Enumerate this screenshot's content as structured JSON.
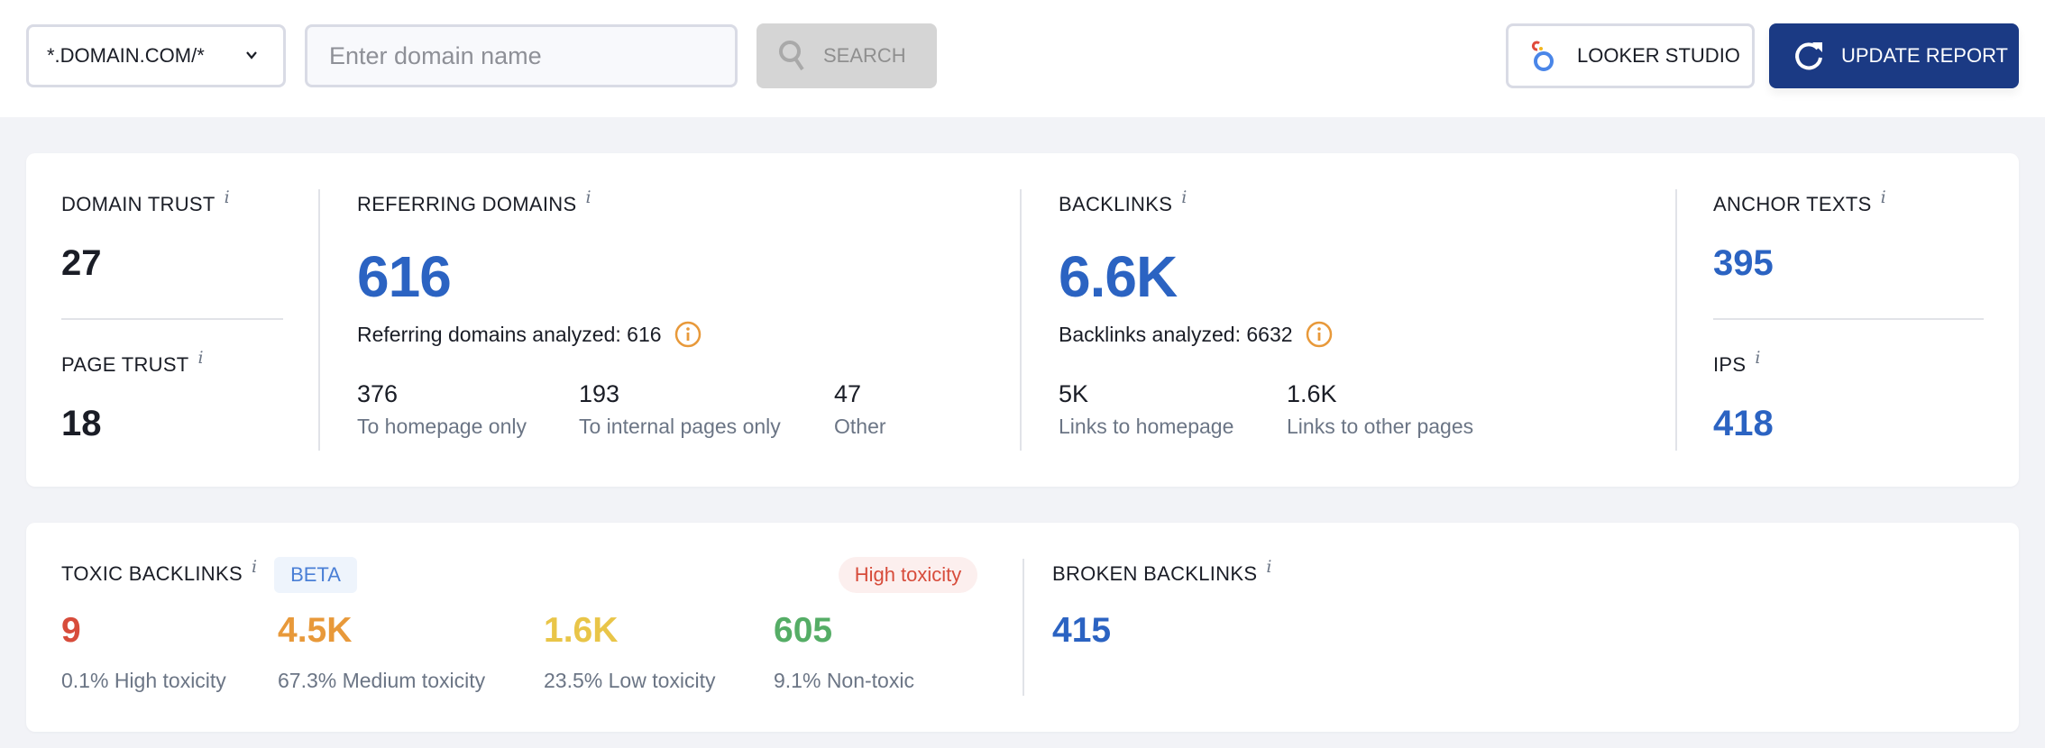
{
  "topbar": {
    "domain_select": {
      "value": "*.DOMAIN.COM/*",
      "icon": "chevron-down-icon"
    },
    "domain_input": {
      "value": "",
      "placeholder": "Enter domain name"
    },
    "search_button": {
      "label": "SEARCH",
      "icon": "search-icon",
      "disabled": true
    },
    "looker_button": {
      "label": "LOOKER STUDIO",
      "icon": "looker-studio-icon"
    },
    "update_button": {
      "label": "UPDATE REPORT",
      "icon": "refresh-icon"
    }
  },
  "overview": {
    "domain_trust": {
      "label": "DOMAIN TRUST",
      "info": "i",
      "value": "27"
    },
    "page_trust": {
      "label": "PAGE TRUST",
      "info": "i",
      "value": "18"
    },
    "referring_domains": {
      "label": "REFERRING DOMAINS",
      "info": "i",
      "value": "616",
      "analyzed": "Referring domains analyzed: 616",
      "breakdown": [
        {
          "value": "376",
          "label": "To homepage only"
        },
        {
          "value": "193",
          "label": "To internal pages only"
        },
        {
          "value": "47",
          "label": "Other"
        }
      ]
    },
    "backlinks": {
      "label": "BACKLINKS",
      "info": "i",
      "value": "6.6K",
      "analyzed": "Backlinks analyzed: 6632",
      "breakdown": [
        {
          "value": "5K",
          "label": "Links to homepage"
        },
        {
          "value": "1.6K",
          "label": "Links to other pages"
        }
      ]
    },
    "anchor_texts": {
      "label": "ANCHOR TEXTS",
      "info": "i",
      "value": "395"
    },
    "ips": {
      "label": "IPS",
      "info": "i",
      "value": "418"
    }
  },
  "toxic": {
    "label": "TOXIC BACKLINKS",
    "info": "i",
    "beta": "BETA",
    "status_badge": "High toxicity",
    "items": [
      {
        "value": "9",
        "label": "0.1% High toxicity",
        "color": "#d74c3b"
      },
      {
        "value": "4.5K",
        "label": "67.3% Medium toxicity",
        "color": "#e8993a"
      },
      {
        "value": "1.6K",
        "label": "23.5% Low toxicity",
        "color": "#e9c548"
      },
      {
        "value": "605",
        "label": "9.1% Non-toxic",
        "color": "#55ad66"
      }
    ]
  },
  "broken": {
    "label": "BROKEN BACKLINKS",
    "info": "i",
    "value": "415"
  },
  "colors": {
    "accent_blue": "#2b63c2",
    "update_button": "#1b3a84",
    "warning_icon": "#e8993a"
  }
}
